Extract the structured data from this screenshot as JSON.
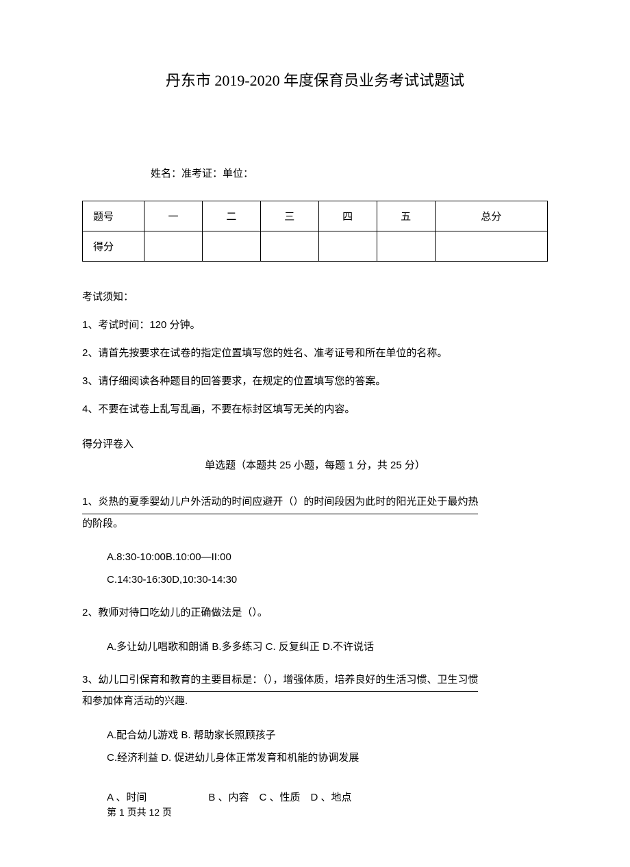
{
  "title": "丹东市 2019-2020 年度保育员业务考试试题试",
  "info_line": "姓名：准考证：单位：",
  "table": {
    "row1": {
      "c0": "题号",
      "c1": "一",
      "c2": "二",
      "c3": "三",
      "c4": "四",
      "c5": "五",
      "c6": "总分"
    },
    "row2": {
      "c0": "得分",
      "c1": "",
      "c2": "",
      "c3": "",
      "c4": "",
      "c5": "",
      "c6": ""
    }
  },
  "notice_title": "考试须知：",
  "notices": {
    "n1": "1、考试时间：120 分钟。",
    "n2": "2、请首先按要求在试卷的指定位置填写您的姓名、准考证号和所在单位的名称。",
    "n3": "3、请仔细阅读各种题目的回答要求，在规定的位置填写您的答案。",
    "n4": "4、不要在试卷上乱写乱画，不要在标封区填写无关的内容。"
  },
  "section": {
    "heading": "得分评卷入",
    "sub": "单选题（本题共 25 小题，每题 1 分，共 25 分）"
  },
  "q1": {
    "line1": "1、炎热的夏季婴幼儿户外活动的时间应避开（）的时间段因为此时的阳光正处于最灼热",
    "line2": "的阶段。",
    "opt1": "A.8:30-10:00B.10:00—II:00",
    "opt2": "C.14:30-16:30D,10:30-14:30"
  },
  "q2": {
    "line": "2、教师对待口吃幼儿的正确做法是（）。",
    "opt": "A.多让幼儿唱歌和朗诵 B.多多练习 C. 反复纠正 D.不许说话"
  },
  "q3": {
    "line1": "3、幼儿口引保育和教育的主要目标是：（），增强体质，培养良好的生活习惯、卫生习惯",
    "line2": "和参加体育活动的兴趣.",
    "opt1": "A.配合幼儿游戏 B. 帮助家长照顾孩子",
    "opt2": "C.经济利益 D. 促进幼儿身体正常发育和机能的协调发展"
  },
  "footer_opts": "A 、时间      B 、内容 C 、性质 D 、地点",
  "footer_page": "第 1 页共 12 页"
}
